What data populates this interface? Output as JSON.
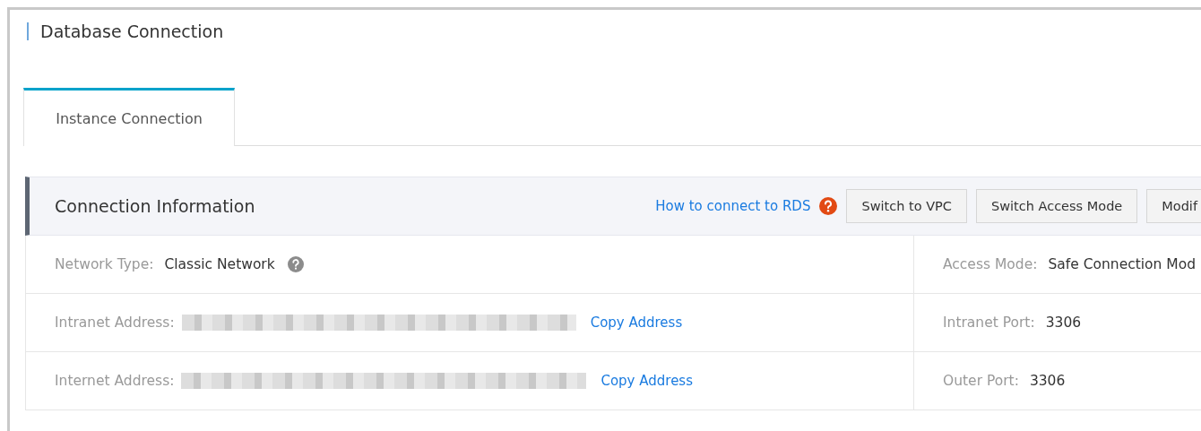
{
  "page": {
    "title": "Database Connection"
  },
  "tabs": [
    {
      "label": "Instance Connection",
      "selected": true
    }
  ],
  "panel": {
    "title": "Connection Information",
    "help_link": "How to connect to RDS",
    "buttons": [
      "Switch to VPC",
      "Switch Access Mode",
      "Modif"
    ],
    "rows": [
      {
        "left": {
          "label": "Network Type:",
          "value": "Classic Network",
          "kind": "help"
        },
        "right": {
          "label": "Access Mode:",
          "value": "Safe Connection Mod"
        }
      },
      {
        "left": {
          "label": "Intranet Address:",
          "kind": "redacted",
          "action": "Copy Address"
        },
        "right": {
          "label": "Intranet Port:",
          "value": "3306"
        }
      },
      {
        "left": {
          "label": "Internet Address:",
          "kind": "redacted",
          "action": "Copy Address"
        },
        "right": {
          "label": "Outer Port:",
          "value": "3306"
        }
      }
    ]
  }
}
